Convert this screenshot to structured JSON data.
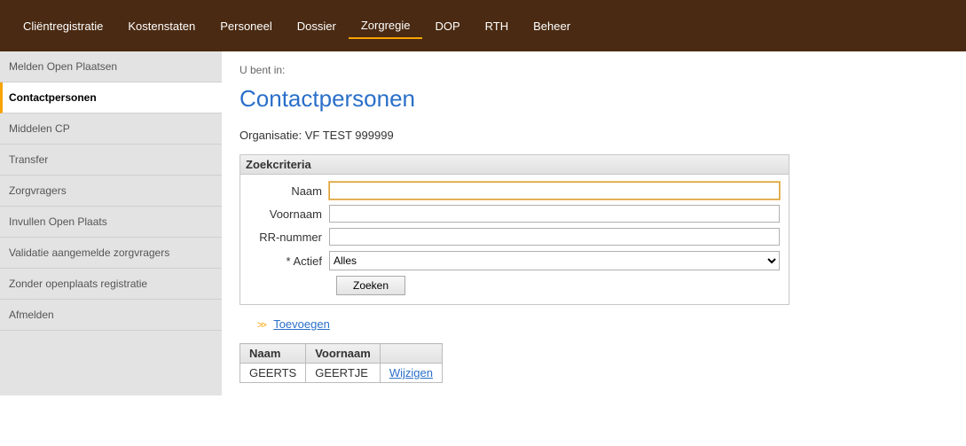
{
  "topnav": [
    {
      "label": "Cliëntregistratie",
      "active": false
    },
    {
      "label": "Kostenstaten",
      "active": false
    },
    {
      "label": "Personeel",
      "active": false
    },
    {
      "label": "Dossier",
      "active": false
    },
    {
      "label": "Zorgregie",
      "active": true
    },
    {
      "label": "DOP",
      "active": false
    },
    {
      "label": "RTH",
      "active": false
    },
    {
      "label": "Beheer",
      "active": false
    }
  ],
  "sidebar": [
    {
      "label": "Melden Open Plaatsen",
      "active": false
    },
    {
      "label": "Contactpersonen",
      "active": true
    },
    {
      "label": "Middelen CP",
      "active": false
    },
    {
      "label": "Transfer",
      "active": false
    },
    {
      "label": "Zorgvragers",
      "active": false
    },
    {
      "label": "Invullen Open Plaats",
      "active": false
    },
    {
      "label": "Validatie aangemelde zorgvragers",
      "active": false
    },
    {
      "label": "Zonder openplaats registratie",
      "active": false
    },
    {
      "label": "Afmelden",
      "active": false
    }
  ],
  "breadcrumb_label": "U bent in:",
  "page_title": "Contactpersonen",
  "org_label": "Organisatie:",
  "org_value": "VF TEST 999999",
  "search": {
    "panel_title": "Zoekcriteria",
    "naam_label": "Naam",
    "naam_value": "",
    "voornaam_label": "Voornaam",
    "voornaam_value": "",
    "rr_label": "RR-nummer",
    "rr_value": "",
    "actief_label": "* Actief",
    "actief_value": "Alles",
    "button": "Zoeken"
  },
  "add_link": "Toevoegen",
  "results": {
    "headers": [
      "Naam",
      "Voornaam",
      ""
    ],
    "rows": [
      {
        "naam": "GEERTS",
        "voornaam": "GEERTJE",
        "action": "Wijzigen"
      }
    ]
  }
}
